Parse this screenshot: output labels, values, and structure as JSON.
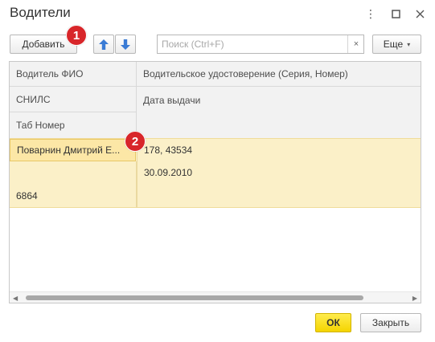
{
  "window": {
    "title": "Водители",
    "more_icon": "more-vertical-icon",
    "maximize_icon": "maximize-icon",
    "close_icon": "close-icon"
  },
  "toolbar": {
    "add_label": "Добавить",
    "move_up_icon": "arrow-up-icon",
    "move_down_icon": "arrow-down-icon",
    "search": {
      "placeholder": "Поиск (Ctrl+F)",
      "value": "",
      "clear_icon": "×"
    },
    "more_label": "Еще",
    "more_caret": "▾"
  },
  "badges": {
    "first": "1",
    "second": "2"
  },
  "table": {
    "headers": {
      "fio": "Водитель ФИО",
      "snils": "СНИЛС",
      "tab_number": "Таб Номер",
      "license": "Водительское удостоверение (Серия, Номер)",
      "issue_date": "Дата выдачи"
    },
    "rows": [
      {
        "fio": "Поварнин Дмитрий Е...",
        "snils": "",
        "tab_number": "6864",
        "license": "178, 43534",
        "issue_date": "30.09.2010"
      }
    ]
  },
  "scrollbar": {
    "left_arrow": "◀",
    "right_arrow": "▶"
  },
  "footer": {
    "ok_label": "ОК",
    "close_label": "Закрыть"
  },
  "colors": {
    "selected_row": "#fbf0c8",
    "selected_cell": "#fce7a6",
    "badge": "#d8262a",
    "ok_button": "#f4d400",
    "arrow_blue": "#3a7bd5"
  }
}
